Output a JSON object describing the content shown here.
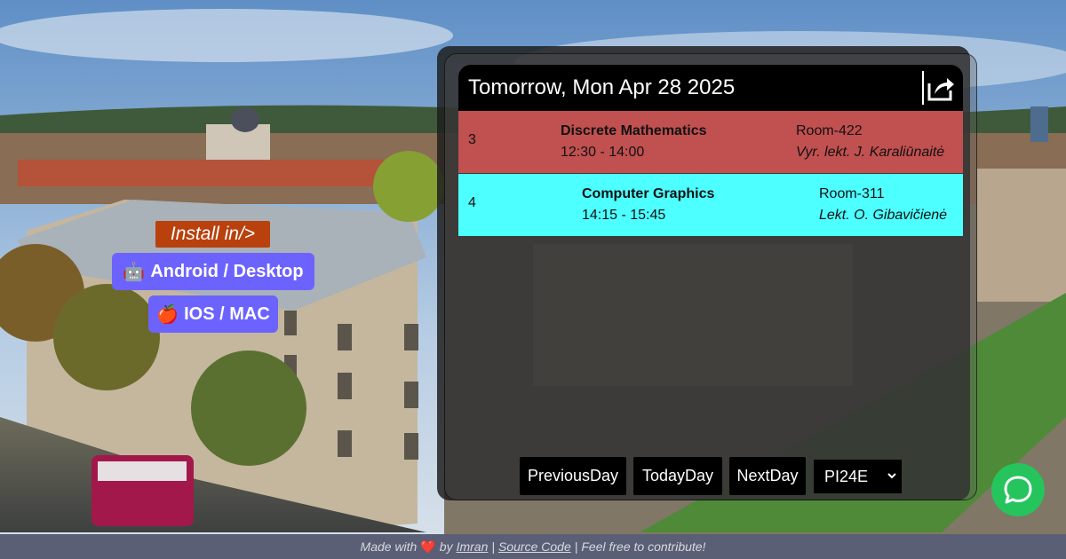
{
  "install": {
    "title": "Install in/>",
    "android_icon": "🤖",
    "android_label": "Android / Desktop",
    "ios_icon": "🍎",
    "ios_label": "IOS / MAC"
  },
  "schedule": {
    "day_title": "Tomorrow, Mon Apr 28 2025",
    "share_icon": "share-icon",
    "lessons": [
      {
        "number": "3",
        "title": "Discrete Mathematics",
        "time": "12:30 - 14:00",
        "room": "Room-422",
        "teacher": "Vyr. lekt. J. Karaliūnaitė",
        "color": "#c15050"
      },
      {
        "number": "4",
        "title": "Computer Graphics",
        "time": "14:15 - 15:45",
        "room": "Room-311",
        "teacher": "Lekt. O. Gibavičienė",
        "color": "#4dffff"
      }
    ],
    "buttons": {
      "previous": "PreviousDay",
      "today": "TodayDay",
      "next": "NextDay"
    },
    "group": "PI24E"
  },
  "footer": {
    "made_with": "Made with",
    "heart": "❤️",
    "by": "by",
    "author": "Imran",
    "separator1": "|",
    "source": "Source Code",
    "separator2": "|",
    "contribute": "Feel free to contribute!"
  },
  "chat_icon": "chat-bubble-icon"
}
